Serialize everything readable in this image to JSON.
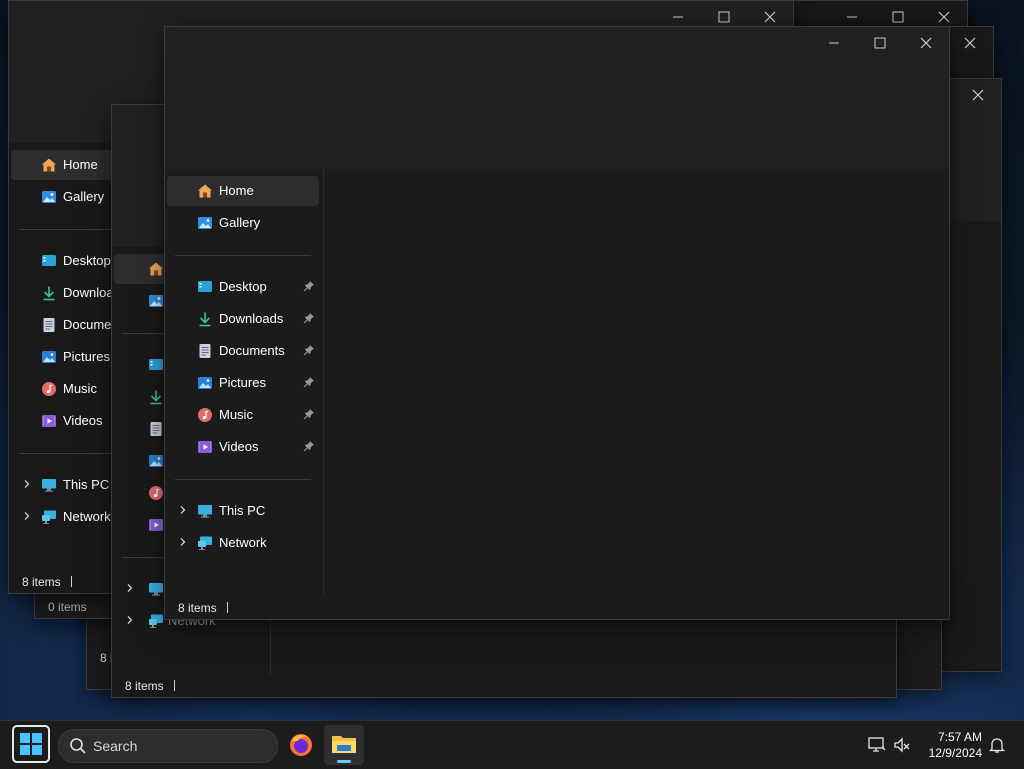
{
  "windows": {
    "back": {
      "nav": {
        "home": "Home",
        "gallery": "Gallery",
        "desktop": "Desktop",
        "downloads": "Downloa",
        "documents": "Documen",
        "pictures": "Pictures",
        "music": "Music",
        "videos": "Videos",
        "this_pc": "This PC",
        "network": "Network"
      },
      "status": "8 items"
    },
    "middle_back": {
      "status": "0 items"
    },
    "middle": {
      "nav": {
        "network": "Network"
      },
      "status": "8 items",
      "status_partial": "8 i"
    },
    "front": {
      "nav": {
        "home": "Home",
        "gallery": "Gallery",
        "desktop": "Desktop",
        "downloads": "Downloads",
        "documents": "Documents",
        "pictures": "Pictures",
        "music": "Music",
        "videos": "Videos",
        "this_pc": "This PC",
        "network": "Network"
      },
      "status": "8 items"
    }
  },
  "taskbar": {
    "search_label": "Search",
    "time": "7:57 AM",
    "date": "12/9/2024",
    "pinned": [
      "start-icon",
      "firefox-icon",
      "file-explorer-icon"
    ]
  },
  "colors": {
    "window_bg": "#191919",
    "accent": "#60cdff",
    "taskbar_bg": "#1c1c1c"
  }
}
